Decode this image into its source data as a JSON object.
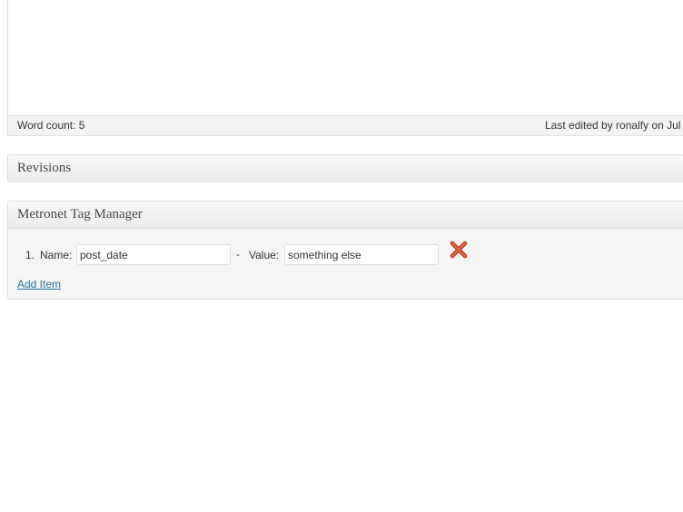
{
  "editor": {
    "word_count": "Word count: 5",
    "last_edited": "Last edited by ronalfy on Jul"
  },
  "revisions": {
    "title": "Revisions"
  },
  "tag_manager": {
    "title": "Metronet Tag Manager",
    "items": [
      {
        "number": "1.",
        "name_label": "Name:",
        "name_value": "post_date",
        "separator": "-",
        "value_label": "Value:",
        "value_value": "something else",
        "remove_icon": "remove-x-icon"
      }
    ],
    "add_item_label": "Add Item"
  },
  "colors": {
    "link": "#21759b",
    "remove": "#d54e21",
    "panel_bg": "#f5f5f5",
    "border": "#dfdfdf"
  }
}
